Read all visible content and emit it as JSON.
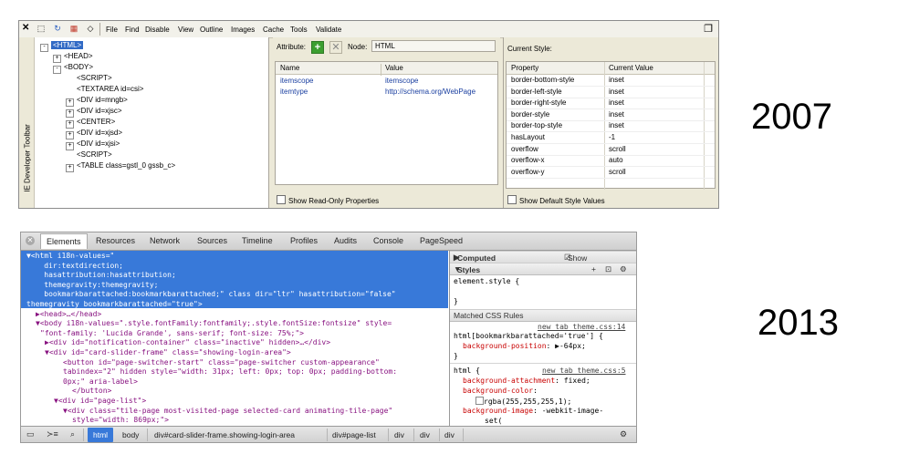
{
  "ie": {
    "close": "✕",
    "menus": [
      "File",
      "Find",
      "Disable",
      "View",
      "Outline",
      "Images",
      "Cache",
      "Tools",
      "Validate"
    ],
    "side_label": "IE Developer Toolbar",
    "tree": [
      {
        "text": "<HTML>",
        "depth": 0,
        "toggle": "-",
        "selected": true
      },
      {
        "text": "<HEAD>",
        "depth": 1,
        "toggle": "+"
      },
      {
        "text": "<BODY>",
        "depth": 1,
        "toggle": "-"
      },
      {
        "text": "<SCRIPT>",
        "depth": 2,
        "toggle": ""
      },
      {
        "text": "<TEXTAREA id=csi>",
        "depth": 2,
        "toggle": ""
      },
      {
        "text": "<DIV id=mngb>",
        "depth": 2,
        "toggle": "+"
      },
      {
        "text": "<DIV id=xjsc>",
        "depth": 2,
        "toggle": "+"
      },
      {
        "text": "<CENTER>",
        "depth": 2,
        "toggle": "+"
      },
      {
        "text": "<DIV id=xjsd>",
        "depth": 2,
        "toggle": "+"
      },
      {
        "text": "<DIV id=xjsi>",
        "depth": 2,
        "toggle": "+"
      },
      {
        "text": "<SCRIPT>",
        "depth": 2,
        "toggle": ""
      },
      {
        "text": "<TABLE class=gstl_0 gssb_c>",
        "depth": 2,
        "toggle": "+"
      }
    ],
    "attr_label": "Attribute:",
    "node_label": "Node:",
    "node_value": "HTML",
    "attr_cols": [
      "Name",
      "Value"
    ],
    "attr_rows": [
      {
        "name": "itemscope",
        "value": "itemscope"
      },
      {
        "name": "itemtype",
        "value": "http://schema.org/WebPage"
      }
    ],
    "show_readonly": "Show Read-Only Properties",
    "style_title": "Current Style:",
    "style_cols": [
      "Property",
      "Current Value"
    ],
    "style_rows": [
      {
        "prop": "border-bottom-style",
        "value": "inset"
      },
      {
        "prop": "border-left-style",
        "value": "inset"
      },
      {
        "prop": "border-right-style",
        "value": "inset"
      },
      {
        "prop": "border-style",
        "value": "inset"
      },
      {
        "prop": "border-top-style",
        "value": "inset"
      },
      {
        "prop": "hasLayout",
        "value": "-1"
      },
      {
        "prop": "overflow",
        "value": "scroll"
      },
      {
        "prop": "overflow-x",
        "value": "auto"
      },
      {
        "prop": "overflow-y",
        "value": "scroll"
      }
    ],
    "show_default": "Show Default Style Values"
  },
  "labels": {
    "y2007": "2007",
    "y2013": "2013"
  },
  "chrome": {
    "tabs": [
      "Elements",
      "Resources",
      "Network",
      "Sources",
      "Timeline",
      "Profiles",
      "Audits",
      "Console",
      "PageSpeed"
    ],
    "dom_selected": [
      "▼<html i18n-values=\"",
      "    dir:textdirection;",
      "    hasattribution:hasattribution;",
      "    themegravity:themegravity;",
      "    bookmarkbarattached:bookmarkbarattached;\" class dir=\"ltr\" hasattribution=\"false\"",
      "themegravity bookmarkbarattached=\"true\">"
    ],
    "dom_rest": [
      {
        "indent": "  ",
        "text": "▶<head>…</head>"
      },
      {
        "indent": "  ",
        "text": "▼<body i18n-values=\".style.fontFamily:fontfamily;.style.fontSize:fontsize\" style="
      },
      {
        "indent": "   ",
        "text": "\"font-family: 'Lucida Grande', sans-serif; font-size: 75%;\">"
      },
      {
        "indent": "    ",
        "text": "▶<div id=\"notification-container\" class=\"inactive\" hidden>…</div>"
      },
      {
        "indent": "    ",
        "text": "▼<div id=\"card-slider-frame\" class=\"showing-login-area\">"
      },
      {
        "indent": "        ",
        "text": "<button id=\"page-switcher-start\" class=\"page-switcher custom-appearance\""
      },
      {
        "indent": "        ",
        "text": "tabindex=\"2\" hidden style=\"width: 31px; left: 0px; top: 0px; padding-bottom:"
      },
      {
        "indent": "        ",
        "text": "0px;\" aria-label>"
      },
      {
        "indent": "          ",
        "text": "</button>"
      },
      {
        "indent": "      ",
        "text": "▼<div id=\"page-list\">"
      },
      {
        "indent": "        ",
        "text": "▼<div class=\"tile-page most-visited-page selected-card animating-tile-page\""
      },
      {
        "indent": "          ",
        "text": "style=\"width: 869px;\">"
      }
    ],
    "computed_style": "Computed Style",
    "show_inherited": "Show inherited",
    "styles": "Styles",
    "element_style": "element.style {",
    "close_brace": "}",
    "matched_rules": "Matched CSS Rules",
    "rule1_src": "new_tab_theme.css:14",
    "rule1_sel": "html[bookmarkbarattached='true'] {",
    "rule1_prop": "background-position",
    "rule1_val": "▶-64px;",
    "rule2_src": "new_tab_theme.css:5",
    "rule2_sel": "html {",
    "rule2_props": [
      {
        "p": "background-attachment",
        "v": "fixed;"
      },
      {
        "p": "background-color",
        "v": ""
      },
      {
        "p": "",
        "v": "rgba(255,255,255,1);"
      },
      {
        "p": "background-image",
        "v": "-webkit-image-"
      },
      {
        "p": "",
        "v": "set("
      }
    ],
    "crumbs": [
      "html",
      "body",
      "div#card-slider-frame.showing-login-area",
      "div#page-list",
      "div",
      "div",
      "div"
    ]
  },
  "colors": {
    "selection": "#3879d9",
    "ie_bg": "#ece9d8",
    "ie_select": "#316ac5"
  }
}
